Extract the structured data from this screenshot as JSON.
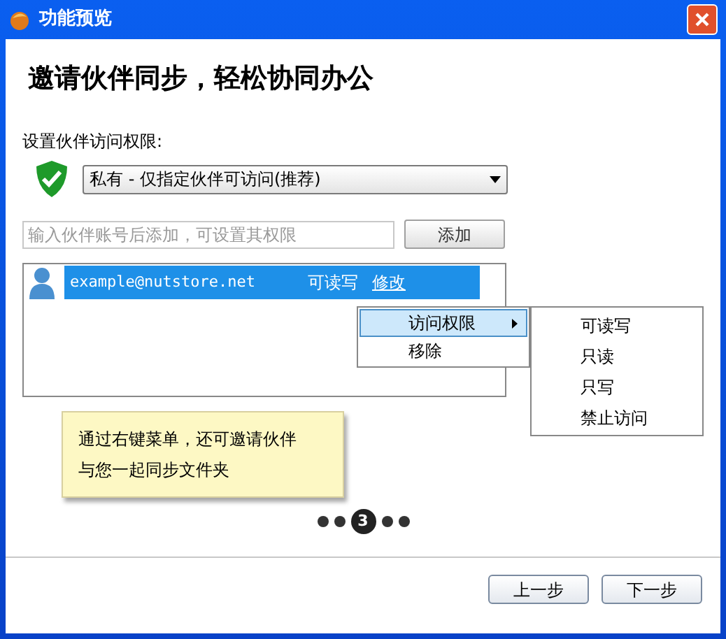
{
  "window": {
    "title": "功能预览"
  },
  "heading": "邀请伙伴同步，轻松协同办公",
  "access": {
    "label": "设置伙伴访问权限:",
    "value": "私有 - 仅指定伙伴可访问(推荐)"
  },
  "add": {
    "placeholder": "输入伙伴账号后添加，可设置其权限",
    "button": "添加"
  },
  "partners": [
    {
      "account": "example@nutstore.net",
      "permission": "可读写",
      "action": "修改",
      "selected": true
    }
  ],
  "context_menu": [
    {
      "label": "访问权限",
      "selected": true,
      "submenu": true
    },
    {
      "label": "移除",
      "selected": false,
      "submenu": false
    }
  ],
  "submenu": [
    "可读写",
    "只读",
    "只写",
    "禁止访问"
  ],
  "tip": [
    "通过右键菜单，还可邀请伙伴",
    "与您一起同步文件夹"
  ],
  "pages": [
    {
      "selected": false
    },
    {
      "selected": false
    },
    {
      "label": "3",
      "selected": true
    },
    {
      "selected": false
    },
    {
      "selected": false
    }
  ],
  "buttons": [
    "上一步",
    "下一步"
  ]
}
